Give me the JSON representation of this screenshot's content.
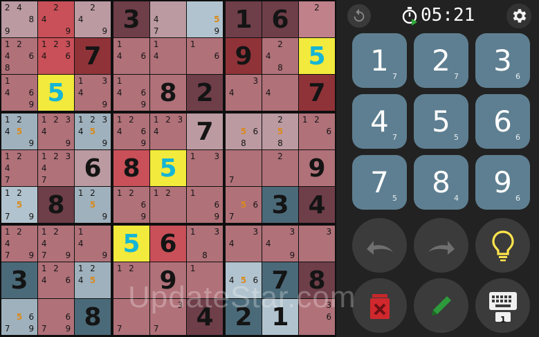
{
  "timer": "05:21",
  "keypad": [
    {
      "digit": "1",
      "remaining": "7"
    },
    {
      "digit": "2",
      "remaining": "7"
    },
    {
      "digit": "3",
      "remaining": "6"
    },
    {
      "digit": "4",
      "remaining": "7"
    },
    {
      "digit": "5",
      "remaining": "5"
    },
    {
      "digit": "6",
      "remaining": "6"
    },
    {
      "digit": "7",
      "remaining": "5"
    },
    {
      "digit": "8",
      "remaining": "4"
    },
    {
      "digit": "9",
      "remaining": "6"
    }
  ],
  "keyboard_badge": "1",
  "watermark": "UpdateStar.com",
  "colors": {
    "pink": "#b07179",
    "pink_light": "#c0818a",
    "red": "#c95058",
    "dark_red": "#8f3338",
    "gray_pink": "#bb9aa2",
    "blue_gray": "#9fb1bd",
    "light_blue": "#b1c3ce",
    "dark_blue": "#4b6a79",
    "wine": "#6e3e49",
    "yellow": "#f2ea3c",
    "key": "#5e7f91",
    "bulb": "#ffe54d",
    "pencil": "#2d9a3b",
    "eraser": "#c8262a"
  },
  "board": [
    [
      "P: 2 ,4,,,,8,9",
      "P:,2,,4,,,,,9",
      "P:,2,,4,,,,,9",
      "B3",
      "P:,,,4,,,7,,",
      "P:,,,,,5h,,,9",
      "B1",
      "B6",
      "P:,2,,,,,,,"
    ],
    [
      "P:1,2,,4,,6,8,,",
      "P:1,2,3,4,,6,,,",
      "B7",
      "P:1,,,4,,6,,,",
      "P:1,,,4,,,,,",
      "P:1,,,,,6,,,",
      "B9",
      "P:,2,,4,,,,8,",
      "Y5"
    ],
    [
      "P:1,,,4,,6,,,9",
      "Y5",
      "P:1,,3,4,,,,,9",
      "P:1,,,4,,6,,,9",
      "B8",
      "B2",
      "P:,,3,4,,,,,",
      "P:,,,4,,,,,",
      "B7"
    ],
    [
      "P:1,2,,4,5h,,,,9",
      "P:1,2,3,4,,,,,9",
      "P:1,2,3,4,5h,,,,9",
      "P:1,2,,4,,6,,,9",
      "P:1,2,3,4,,,,,",
      "B7",
      "P:,,,,5h,6,,8,",
      "P:,2,,,5h,,,8,",
      "P:1,2,,,,6,,,"
    ],
    [
      "P:1,2,,4,,,7,,",
      "P:1,2,3,4,,,7,,",
      "B6",
      "B8",
      "Y5",
      "P:1,,3,,,,,,",
      "P:,,,,,,7,,",
      "P:,2,,,,,,,",
      "B9"
    ],
    [
      "P:1,2,,,5h,,7,,9",
      "B8",
      "P:1,2,,,5h,,,,9",
      "P:1,2,,,,6,,,9",
      "P:1,2,,,,,,,",
      "P:1,,,,,6,,,9",
      "P:,,,,5h,6,7,,",
      "B3",
      "B4"
    ],
    [
      "P:1,2,,4,,,7,,9",
      "P:1,2,,4,,,7,,9",
      "P:1,,,4,,,,,9",
      "Y5",
      "B6",
      "P:1,,3,,,,,8,",
      "P:,,3,4,,,,,",
      "P:,,3,4,,,,,9",
      "P:,,3,,,,,,"
    ],
    [
      "B3",
      "P:1,2,,4,,6,,,",
      "P:1,2,,4,5h,,,,",
      "P:1,2,,,,,,,",
      "B9",
      "P:1,,,,,,,,",
      "P:,,,4,5h,6,,,",
      "B7",
      "B8"
    ],
    [
      "P:,,,,5h,6,7,,9",
      "P:,,,,,6,7,,9",
      "B8",
      "P:,,,,,,7,,",
      "P:,,3,,,,7,,",
      "B4",
      "B2",
      "B1",
      "P:,,3,,,6,,,"
    ]
  ]
}
